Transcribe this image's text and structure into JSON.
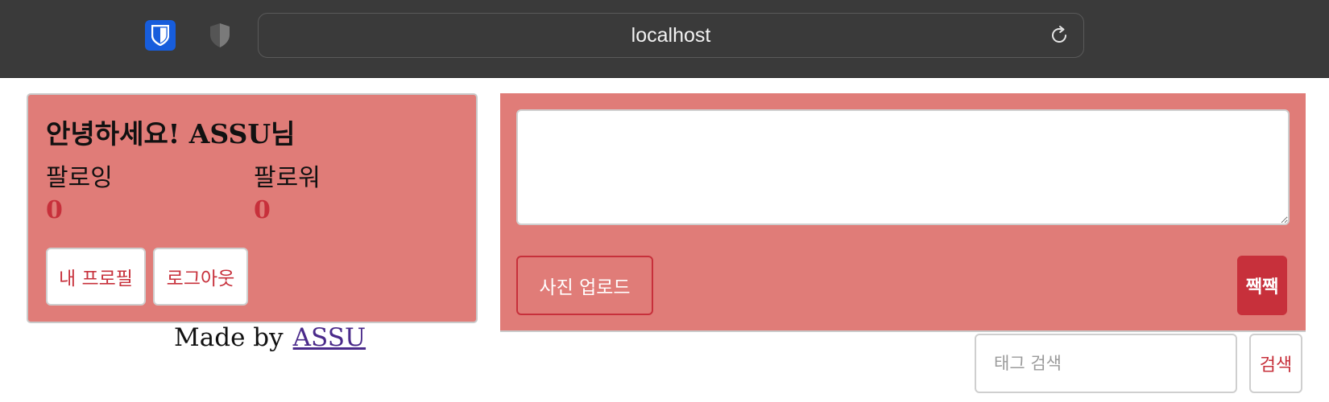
{
  "browser": {
    "url": "localhost",
    "extensions": [
      {
        "icon": "bitwarden-icon",
        "color": "#175ddc"
      },
      {
        "icon": "shield-icon"
      }
    ],
    "reload_icon": "reload-icon"
  },
  "profile": {
    "greeting": "안녕하세요! ASSU님",
    "following_label": "팔로잉",
    "following_count": "0",
    "follower_label": "팔로워",
    "follower_count": "0",
    "my_profile_button": "내 프로필",
    "logout_button": "로그아웃"
  },
  "footer": {
    "made_by": "Made by",
    "author_link": "ASSU"
  },
  "compose": {
    "textarea_value": "",
    "photo_upload_button": "사진 업로드",
    "tweet_button": "짹짹"
  },
  "tag_search": {
    "placeholder": "태그 검색",
    "button": "검색"
  },
  "colors": {
    "card_bg": "#e07c78",
    "accent": "#c7303b",
    "toolbar_bg": "#3a3a3a"
  }
}
